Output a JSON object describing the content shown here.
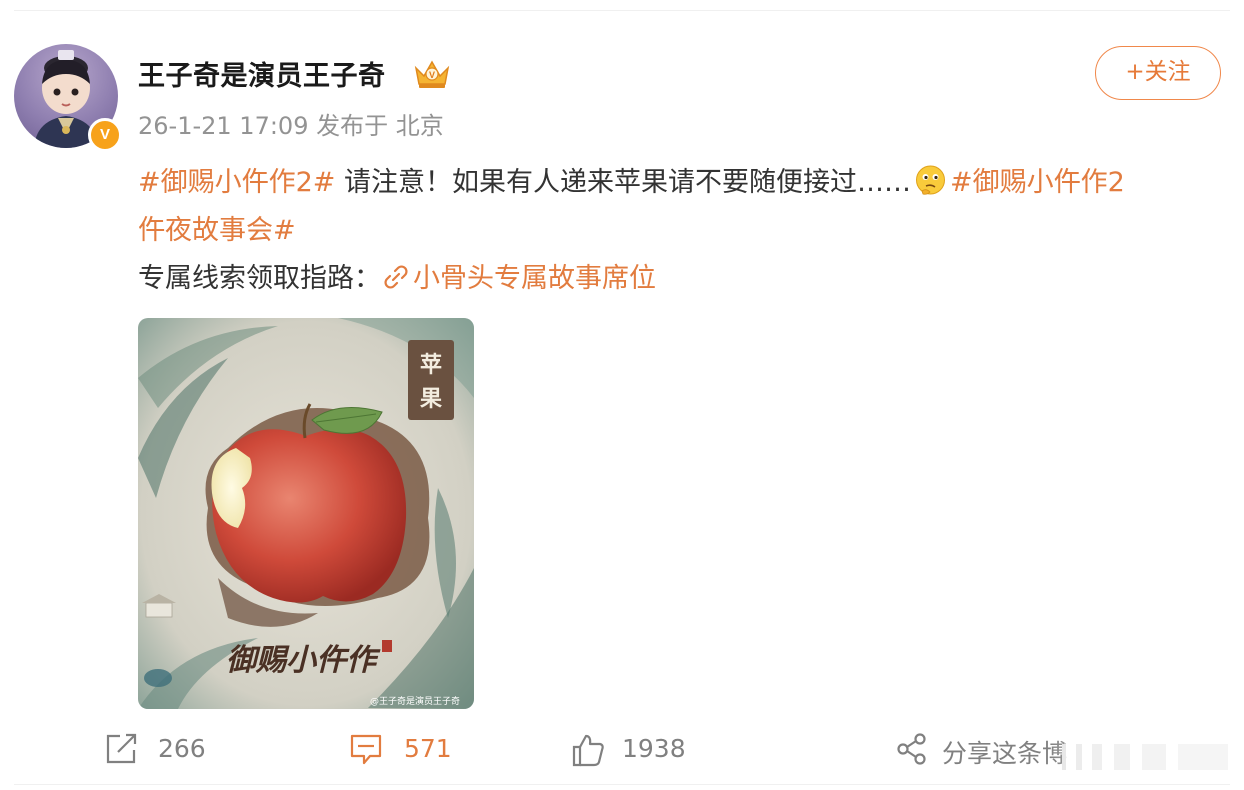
{
  "post": {
    "username": "王子奇是演员王子奇",
    "verified_badge": "V",
    "meta": "26-1-21 17:09 发布于 北京",
    "follow_label": "+关注",
    "hashtag1": "#御赐小仵作2#",
    "body_text": " 请注意！如果有人递来苹果请不要随便接过……",
    "hashtag2_part1": "#御赐小仵作2",
    "hashtag2_part2": "仵夜故事会#",
    "clue_label": "专属线索领取指路：",
    "clue_link": "小骨头专属故事席位",
    "image": {
      "stamp_text": [
        "苹",
        "果"
      ],
      "calligraphy": "御赐小仵作",
      "watermark": "@王子奇是演员王子奇"
    }
  },
  "actions": {
    "repost_count": "266",
    "comment_count": "571",
    "like_count": "1938",
    "share_label": "分享这条博"
  },
  "colors": {
    "accent": "#e27c3f",
    "verified": "#f7a21b",
    "muted": "#939393"
  },
  "icons": [
    "crown-icon",
    "thinking-emoji-icon",
    "link-icon",
    "repost-icon",
    "comment-icon",
    "like-icon",
    "share-icon"
  ]
}
